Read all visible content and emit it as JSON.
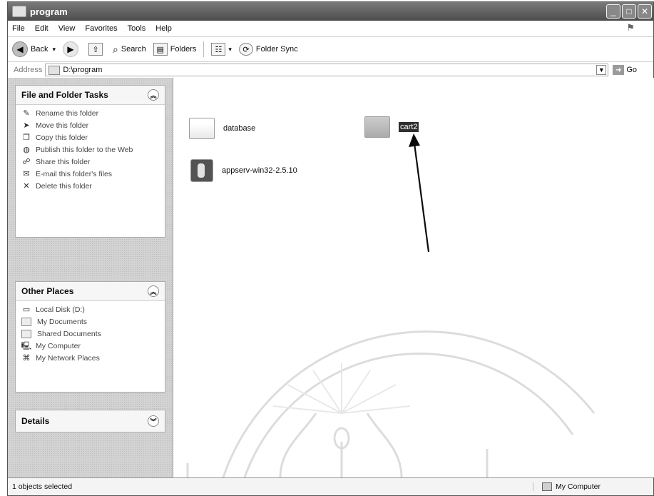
{
  "window": {
    "title": "program"
  },
  "menubar": {
    "items": [
      "File",
      "Edit",
      "View",
      "Favorites",
      "Tools",
      "Help"
    ]
  },
  "toolbar": {
    "back_label": "Back",
    "search_label": "Search",
    "folders_label": "Folders",
    "folder_sync_label": "Folder Sync"
  },
  "address": {
    "label": "Address",
    "value": "D:\\program",
    "go_label": "Go"
  },
  "file_tasks": {
    "title": "File and Folder Tasks",
    "items": [
      "Rename this folder",
      "Move this folder",
      "Copy this folder",
      "Publish this folder to the Web",
      "Share this folder",
      "E-mail this folder's files",
      "Delete this folder"
    ]
  },
  "other_places": {
    "title": "Other Places",
    "items": [
      "Local Disk (D:)",
      "My Documents",
      "Shared Documents",
      "My Computer",
      "My Network Places"
    ]
  },
  "details": {
    "title": "Details"
  },
  "files": [
    {
      "name": "database",
      "icon": "folder-icon"
    },
    {
      "name": "cart2",
      "icon": "folder-icon",
      "selected": true
    },
    {
      "name": "appserv-win32-2.5.10",
      "icon": "installer-icon"
    }
  ],
  "status": {
    "left": "1 objects selected",
    "right": "My Computer"
  }
}
